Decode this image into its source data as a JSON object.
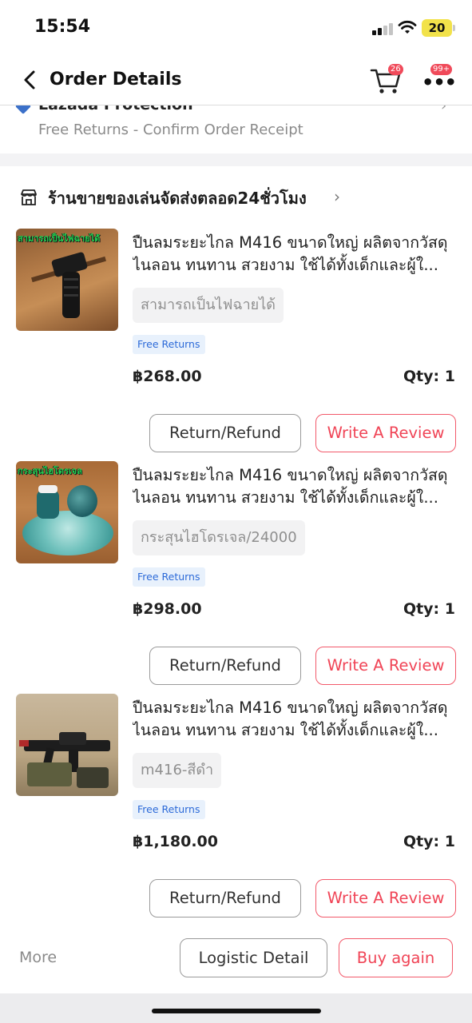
{
  "status": {
    "time": "15:54",
    "battery": "20"
  },
  "header": {
    "title": "Order Details",
    "cart_badge": "26",
    "more_badge": "99+"
  },
  "protection": {
    "title": "Lazada Protection",
    "subtitle": "Free Returns - Confirm Order Receipt"
  },
  "shop": {
    "name": "ร้านขายของเล่นจัดส่งตลอด24ชั่วโมง"
  },
  "items": [
    {
      "title": "ปืนลมระยะไกล M416 ขนาดใหญ่ ผลิตจากวัสดุไนลอน ทนทาน สวยงาม ใช้ได้ทั้งเด็กและผู้ใ...",
      "thumb_label": "สามารถเป็นไฟฉายได้",
      "variant": "สามารถเป็นไฟฉายได้",
      "badge": "Free Returns",
      "price": "฿268.00",
      "qty": "Qty: 1",
      "return_label": "Return/Refund",
      "review_label": "Write A Review"
    },
    {
      "title": "ปืนลมระยะไกล M416 ขนาดใหญ่ ผลิตจากวัสดุไนลอน ทนทาน สวยงาม ใช้ได้ทั้งเด็กและผู้ใ...",
      "thumb_label": "กระสุนไฮโดรเจล",
      "variant": "กระสุนไฮโดรเจล/24000",
      "badge": "Free Returns",
      "price": "฿298.00",
      "qty": "Qty: 1",
      "return_label": "Return/Refund",
      "review_label": "Write A Review"
    },
    {
      "title": "ปืนลมระยะไกล M416 ขนาดใหญ่ ผลิตจากวัสดุไนลอน ทนทาน สวยงาม ใช้ได้ทั้งเด็กและผู้ใ...",
      "thumb_label": "",
      "variant": "m416-สีดำ",
      "badge": "Free Returns",
      "price": "฿1,180.00",
      "qty": "Qty: 1",
      "return_label": "Return/Refund",
      "review_label": "Write A Review"
    }
  ],
  "footer": {
    "more": "More",
    "logistic_label": "Logistic Detail",
    "buy_again_label": "Buy again"
  },
  "colors": {
    "accent": "#f04456",
    "badge": "#f04a5a",
    "free_returns_text": "#2c6ad8",
    "free_returns_bg": "#e8f1fc",
    "protection_icon": "#3b70c9"
  }
}
